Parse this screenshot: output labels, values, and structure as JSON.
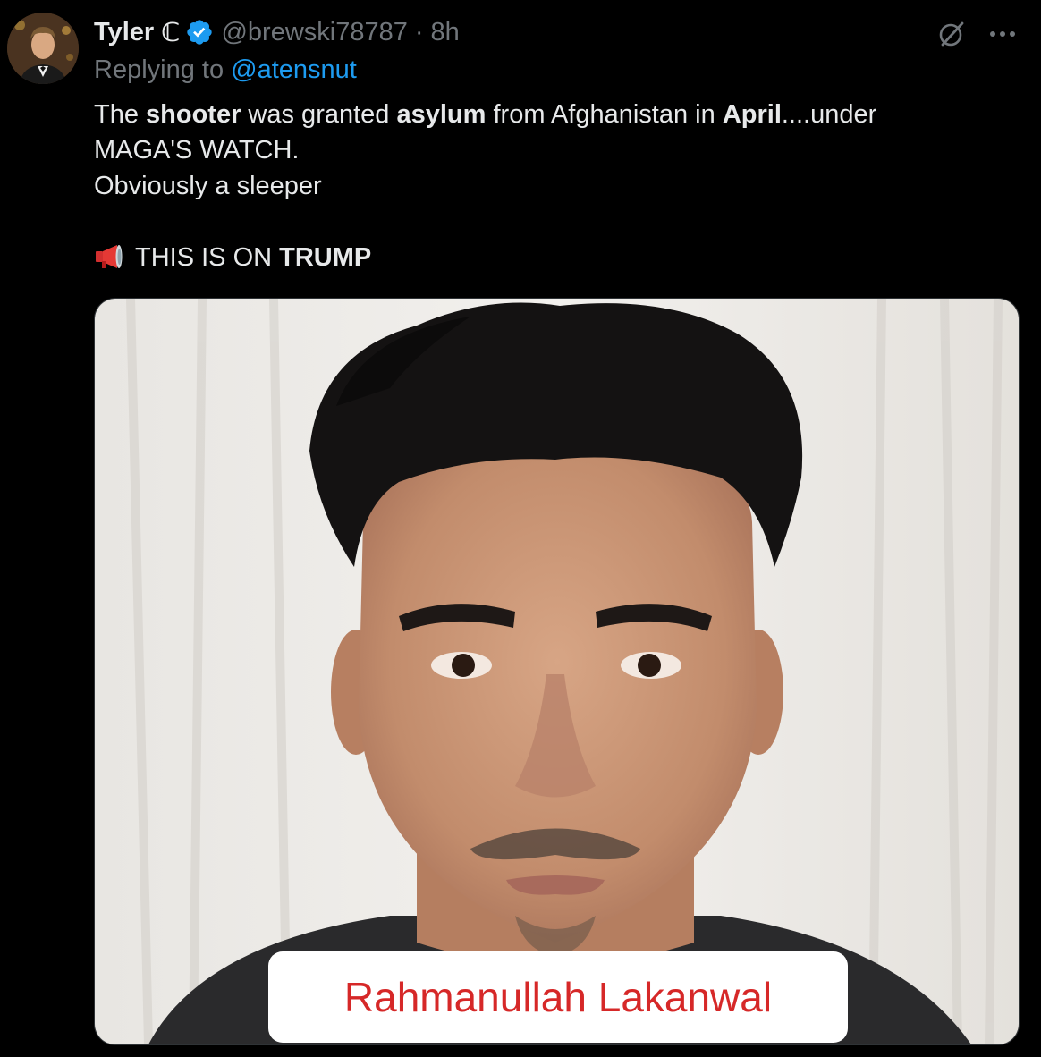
{
  "tweet": {
    "display_name": "Tyler",
    "name_badge": "ℂ",
    "verified_icon": "verified-badge-icon",
    "handle": "@brewski78787",
    "separator": "·",
    "time": "8h",
    "replying_to_label": "Replying to",
    "replying_to_handle": "@atensnut",
    "text": {
      "l1_a": "The ",
      "l1_b": "shooter",
      "l1_c": " was granted ",
      "l1_d": "asylum",
      "l1_e": " from Afghanistan in ",
      "l1_f": "April",
      "l1_g": "....under",
      "l2": "MAGA'S WATCH.",
      "l3": "Obviously a sleeper",
      "l4_icon": "megaphone-icon",
      "l4_a": "THIS IS ON ",
      "l4_b": "TRUMP"
    },
    "media": {
      "caption": "Rahmanullah Lakanwal"
    }
  },
  "icons": {
    "grok": "grok-icon",
    "more": "more-icon"
  },
  "colors": {
    "background": "#000000",
    "text": "#e7e9ea",
    "secondary": "#71767b",
    "link": "#1d9bf0",
    "verified": "#1d9bf0",
    "caption": "#d62828"
  }
}
